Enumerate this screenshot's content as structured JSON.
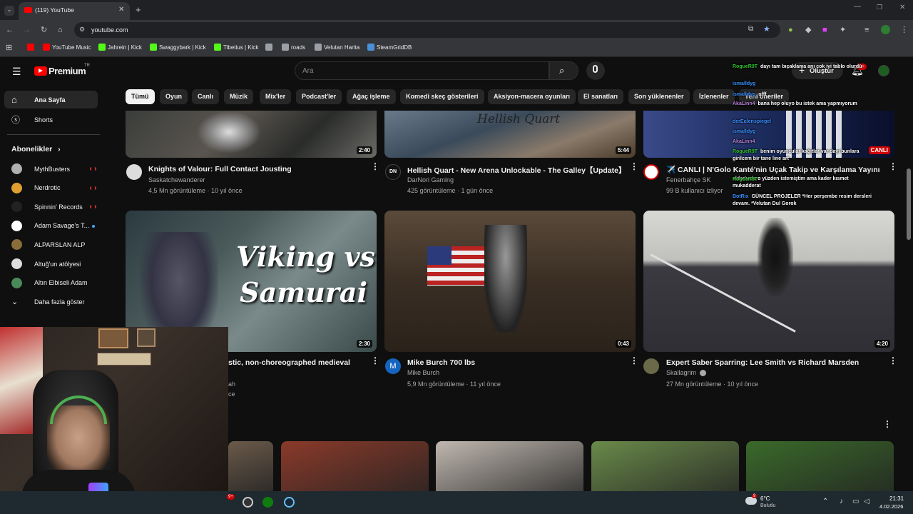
{
  "browser": {
    "tab_title": "(119) YouTube",
    "new_tab_symbol": "+",
    "url": "youtube.com",
    "bookmarks": [
      {
        "label": "",
        "color": "#ff0000"
      },
      {
        "label": "YouTube Music",
        "color": "#ff0000"
      },
      {
        "label": "Jahrein | Kick",
        "color": "#53fc18"
      },
      {
        "label": "Swaggybark | Kick",
        "color": "#53fc18"
      },
      {
        "label": "Tibetius | Kick",
        "color": "#53fc18"
      },
      {
        "label": "",
        "color": "#9aa0a6"
      },
      {
        "label": "roads",
        "color": "#9aa0a6"
      },
      {
        "label": "Velutan Harita",
        "color": "#9aa0a6"
      },
      {
        "label": "SteamGridDB",
        "color": "#4a90d9"
      }
    ]
  },
  "youtube": {
    "logo_text": "Premium",
    "logo_suffix": "TR",
    "search_placeholder": "Ara",
    "create_label": "Oluştur",
    "notification_count": "9+",
    "chips": [
      "Tümü",
      "Oyun",
      "Canlı",
      "Müzik",
      "Mix'ler",
      "Podcast'ler",
      "Ağaç işleme",
      "Komedi skeç gösterileri",
      "Aksiyon-macera oyunları",
      "El sanatları",
      "Son yüklenenler",
      "İzlenenler",
      "Yeni öneriler"
    ],
    "sidebar": {
      "home": "Ana Sayfa",
      "shorts": "Shorts",
      "subscriptions_header": "Abonelikler",
      "show_more": "Daha fazla göster",
      "channels": [
        {
          "name": "MythBusters",
          "color": "#b0b0b0",
          "live": true
        },
        {
          "name": "Nerdrotic",
          "color": "#e0a030",
          "live": true
        },
        {
          "name": "Spinnin' Records",
          "color": "#222222",
          "live": true
        },
        {
          "name": "Adam Savage's T...",
          "color": "#ffffff",
          "live": false
        },
        {
          "name": "ALPARSLAN ALP",
          "color": "#8a6d3b",
          "live": false
        },
        {
          "name": "Altuğ'un atölyesi",
          "color": "#dddddd",
          "live": false
        },
        {
          "name": "Altın Elbiseli Adam",
          "color": "#4a8a5a",
          "live": false
        }
      ]
    },
    "videos": [
      {
        "title": "Knights of Valour: Full Contact Jousting",
        "channel": "Saskatchewanderer",
        "meta": "4,5 Mn görüntüleme · 10 yıl önce",
        "duration": "2:40",
        "avatar": "#dddddd"
      },
      {
        "title": "Hellish Quart - New Arena Unlockable - The Galley【Update】",
        "channel": "DarNori Gaming",
        "meta": "425 görüntüleme · 1 gün önce",
        "duration": "5:44",
        "avatar": "#111111",
        "thumb_text": "Hellish Quart"
      },
      {
        "title": "✈️ CANLI | N'Golo Kanté'nin Uçak Takip ve Karşılama Yayını",
        "channel": "Fenerbahçe SK",
        "meta": "99 B kullanıcı izliyor",
        "duration": "CANLI",
        "avatar": "#ffffff"
      },
      {
        "title": "stic, non-choreographed medieval",
        "channel": "ah",
        "meta": "ce",
        "duration": "2:30",
        "avatar": "#444444",
        "thumb_text_1": "Viking vs",
        "thumb_text_2": "Samurai"
      },
      {
        "title": "Mike Burch 700 lbs",
        "channel": "Mike Burch",
        "meta": "5,9 Mn görüntüleme · 11 yıl önce",
        "duration": "0:43",
        "avatar": "#1565c0",
        "avatar_letter": "M"
      },
      {
        "title": "Expert Saber Sparring: Lee Smith vs Richard Marsden",
        "channel": "Skallagrim",
        "meta": "27 Mn görüntüleme · 10 yıl önce",
        "duration": "4:20",
        "avatar": "#6a6a4a"
      }
    ],
    "shorts_thumbs": [
      "#6b5a4a",
      "#8a3a2a",
      "#c0b8b0",
      "#6a8a4a",
      "#3a6a2a"
    ]
  },
  "chat": [
    {
      "user": "RogueR9T",
      "text": "dayı tam bıçaklama anı çok iyi tablo olurdu",
      "color": "#31c231"
    },
    {
      "user": "ismalldyg",
      "text": "",
      "color": "#3b8fff"
    },
    {
      "user": "ismalldyg",
      "text": "offf",
      "color": "#3b8fff"
    },
    {
      "user": "AkaLinn4",
      "text": "bana hep oluyo bu istek ama yapmıyorum",
      "color": "#b57ed6"
    },
    {
      "user": "derEulenspiegel",
      "text": "",
      "color": "#3b8fff"
    },
    {
      "user": "ismalldyg",
      "text": "",
      "color": "#3b8fff"
    },
    {
      "user": "AkaLinn4",
      "text": "",
      "color": "#b57ed6"
    },
    {
      "user": "RogueR9T",
      "text": "benim oyuncular kağıtlar var dayı bunlara girilcem bir tane line art",
      "color": "#31c231"
    },
    {
      "user": "",
      "text": "aldor'u de o yüzden istemiştim ama kader kısmet mukadderat",
      "color": "#ffffff"
    },
    {
      "user": "RogueR9T",
      "text": "",
      "color": "#31c231"
    },
    {
      "user": "BotRix",
      "text": "GÜNCEL PROJELER *Her perşembe resim dersleri devam. *Velutan Dul Gorok",
      "color": "#3b8fff"
    }
  ],
  "taskbar": {
    "weather_temp": "6°C",
    "weather_desc": "Bulutlu",
    "weather_badge": "9",
    "time": "21:31",
    "date": "4.02.2026",
    "app_badge": "9+"
  },
  "colors": {
    "accent": "#ff0000",
    "live": "#cc0000"
  }
}
